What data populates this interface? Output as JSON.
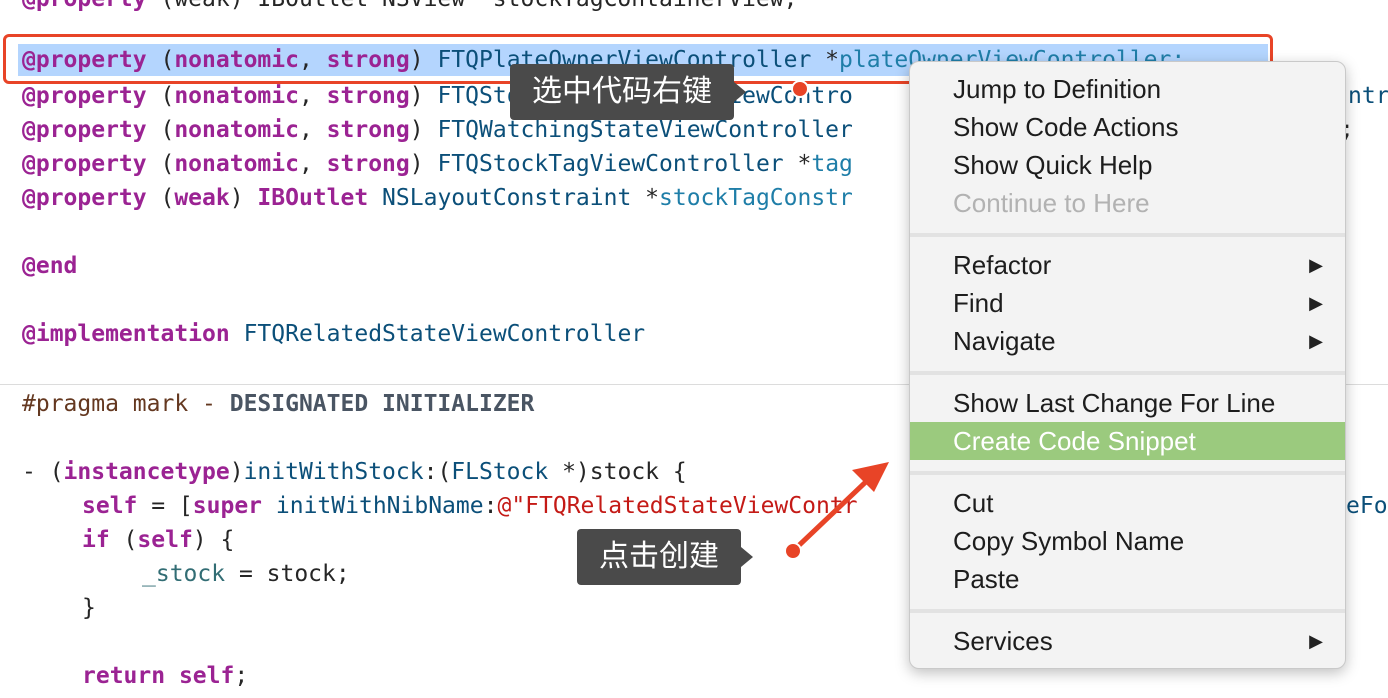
{
  "code": {
    "line0": {
      "at": "@property",
      "rest": " (weak) IBOutlet NSView *stockTagContainerView;"
    },
    "line1": {
      "at": "@property",
      "open": " (",
      "kw1": "nonatomic",
      "comma": ", ",
      "kw2": "strong",
      "close": ") ",
      "type": "FTQPlateOwnerViewController",
      "star": " *",
      "name": "plateOwnerViewController;"
    },
    "line2": {
      "at": "@property",
      "open": " (",
      "kw1": "nonatomic",
      "comma": ", ",
      "kw2": "strong",
      "close": ") ",
      "type": "FTQStockRelatedStateViewContro",
      "tail": "ntr"
    },
    "line3": {
      "at": "@property",
      "open": " (",
      "kw1": "nonatomic",
      "comma": ", ",
      "kw2": "strong",
      "close": ") ",
      "type": "FTQWatchingStateViewController",
      "tail": ";"
    },
    "line4": {
      "at": "@property",
      "open": " (",
      "kw1": "nonatomic",
      "comma": ", ",
      "kw2": "strong",
      "close": ") ",
      "type": "FTQStockTagViewController",
      "star": " *",
      "name": "tag"
    },
    "line5": {
      "at": "@property",
      "open": " (",
      "kw1": "weak",
      "close": ") ",
      "kw2": "IBOutlet",
      "type": " NSLayoutConstraint",
      "star": " *",
      "name": "stockTagConstr"
    },
    "line6": {
      "at": "@end"
    },
    "line7": {
      "at": "@implementation",
      "name": " FTQRelatedStateViewController"
    },
    "line8": {
      "pragma": "#pragma mark - ",
      "mark": "DESIGNATED INITIALIZER"
    },
    "line9": {
      "dash": "- (",
      "kw": "instancetype",
      "close": ")",
      "sel": "initWithStock",
      "colon": ":(",
      "type": "FLStock",
      "star": " *)stock {"
    },
    "line10": {
      "kw": "self",
      "eq": " = [",
      "kw2": "super",
      "sp": " ",
      "sel": "initWithNibName",
      "colon": ":",
      "str": "@\"FTQRelatedStateViewContr",
      "tail": "eFo"
    },
    "line11": {
      "kw": "if",
      "rest": " (",
      "kw2": "self",
      "close": ") {"
    },
    "line12": {
      "ident": "_stock",
      "rest": " = stock;"
    },
    "line13": {
      "rest": "}"
    },
    "line14": {
      "kw": "return",
      "sp": " ",
      "kw2": "self",
      "rest": ";"
    }
  },
  "menu": {
    "items": [
      {
        "label": "Jump to Definition"
      },
      {
        "label": "Show Code Actions"
      },
      {
        "label": "Show Quick Help"
      },
      {
        "label": "Continue to Here"
      },
      {
        "label": "Refactor"
      },
      {
        "label": "Find"
      },
      {
        "label": "Navigate"
      },
      {
        "label": "Show Last Change For Line"
      },
      {
        "label": "Create Code Snippet"
      },
      {
        "label": "Cut"
      },
      {
        "label": "Copy Symbol Name"
      },
      {
        "label": "Paste"
      },
      {
        "label": "Services"
      }
    ],
    "submenu_arrow": "▶",
    "highlight_color": "#9bca7e"
  },
  "annotations": {
    "select_right_click": "选中代码右键",
    "click_create": "点击创建",
    "accent_color": "#e84427"
  }
}
